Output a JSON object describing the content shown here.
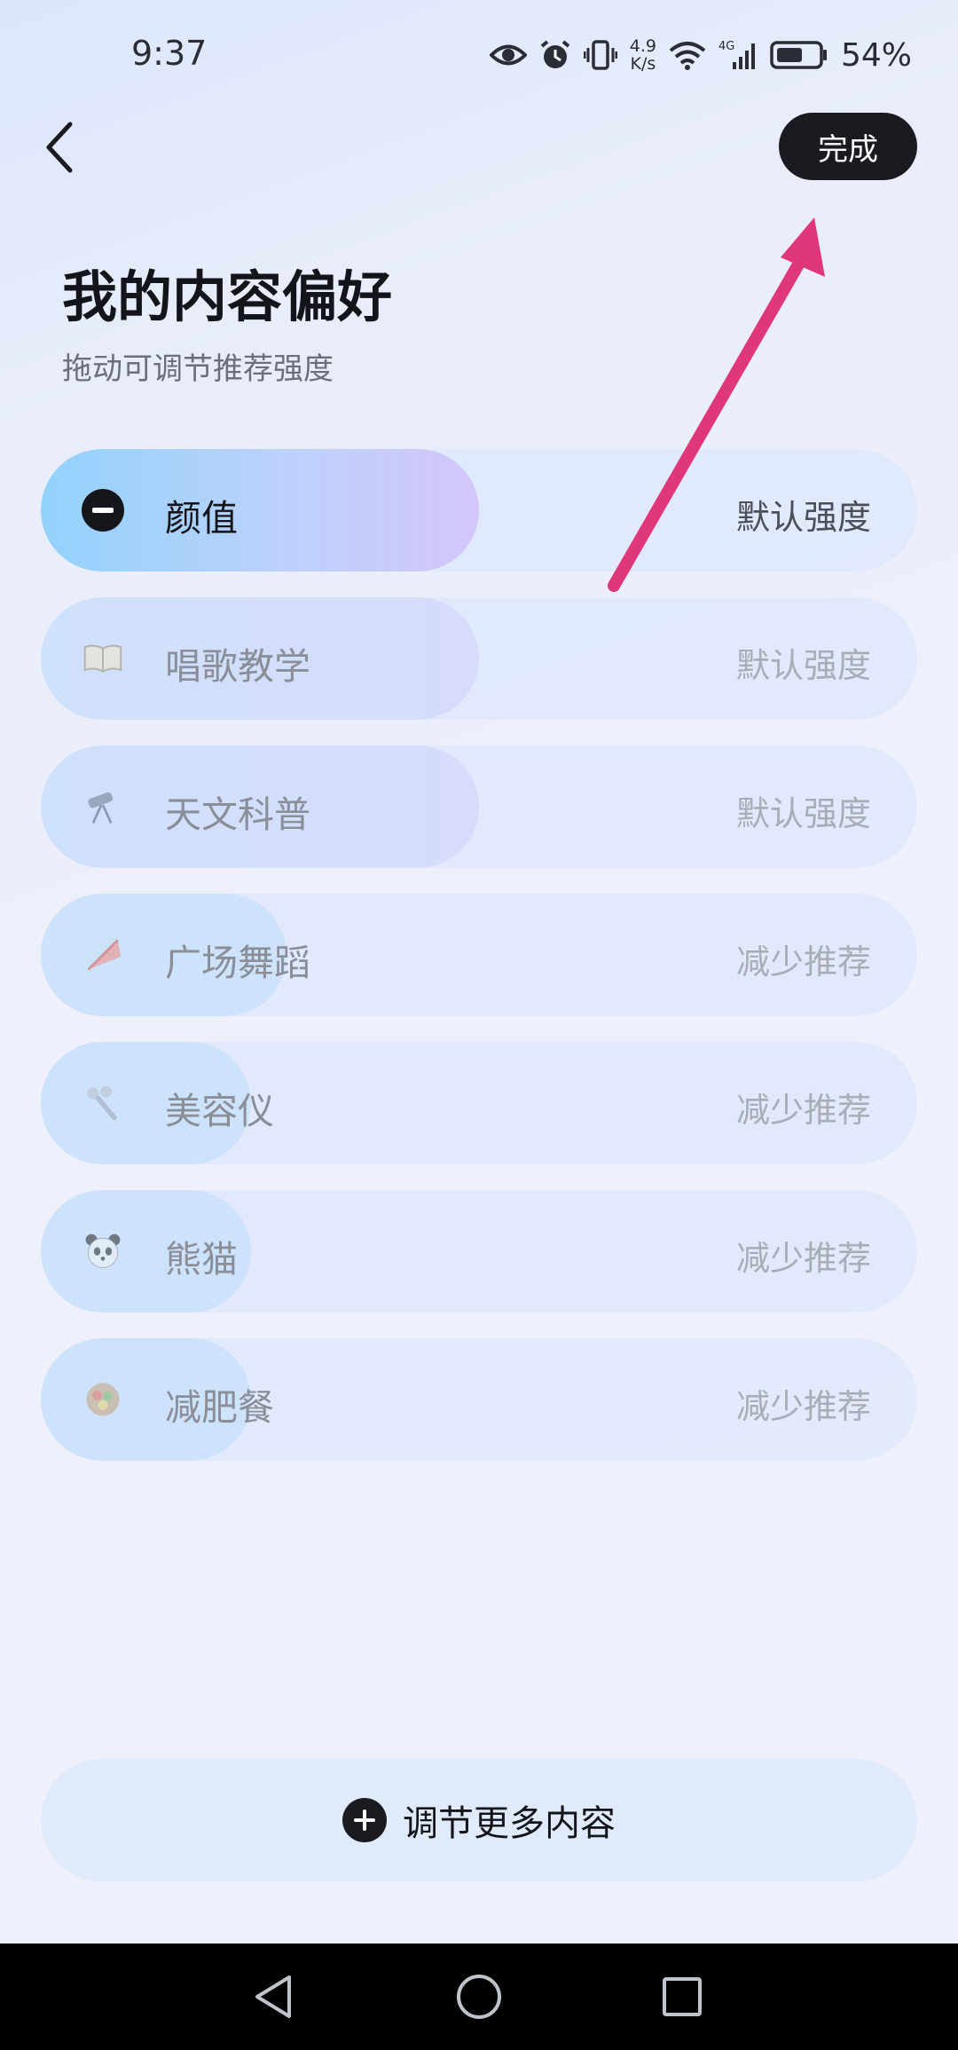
{
  "status_bar": {
    "time": "9:37",
    "net_speed_value": "4.9",
    "net_speed_unit": "K/s",
    "network_type": "4G",
    "battery_percent": "54%",
    "icons": [
      "eye-icon",
      "alarm-icon",
      "vibrate-icon",
      "wifi-icon",
      "signal-icon",
      "battery-icon"
    ]
  },
  "header": {
    "back_icon": "chevron-left-icon",
    "done_label": "完成"
  },
  "page": {
    "title": "我的内容偏好",
    "subtitle": "拖动可调节推荐强度"
  },
  "preferences": [
    {
      "label": "颜值",
      "strength": "默认强度",
      "icon": "minus-circle-icon",
      "level": 0.5
    },
    {
      "label": "唱歌教学",
      "strength": "默认强度",
      "icon": "open-book-icon",
      "level": 0.5
    },
    {
      "label": "天文科普",
      "strength": "默认强度",
      "icon": "telescope-icon",
      "level": 0.5
    },
    {
      "label": "广场舞蹈",
      "strength": "减少推荐",
      "icon": "fan-dance-icon",
      "level": 0.28
    },
    {
      "label": "美容仪",
      "strength": "减少推荐",
      "icon": "beauty-device-icon",
      "level": 0.24
    },
    {
      "label": "熊猫",
      "strength": "减少推荐",
      "icon": "panda-icon",
      "level": 0.24
    },
    {
      "label": "减肥餐",
      "strength": "减少推荐",
      "icon": "salad-bowl-icon",
      "level": 0.24
    }
  ],
  "footer": {
    "adjust_more_label": "调节更多内容",
    "adjust_more_icon": "plus-circle-icon"
  },
  "colors": {
    "done_button_bg": "#1a1b20",
    "arrow_annotation": "#e0367a",
    "active_fill_start": "#92d2fb",
    "active_fill_end": "#d3c6fa"
  },
  "nav": {
    "icons": [
      "back-triangle-icon",
      "home-circle-icon",
      "recents-square-icon"
    ]
  }
}
